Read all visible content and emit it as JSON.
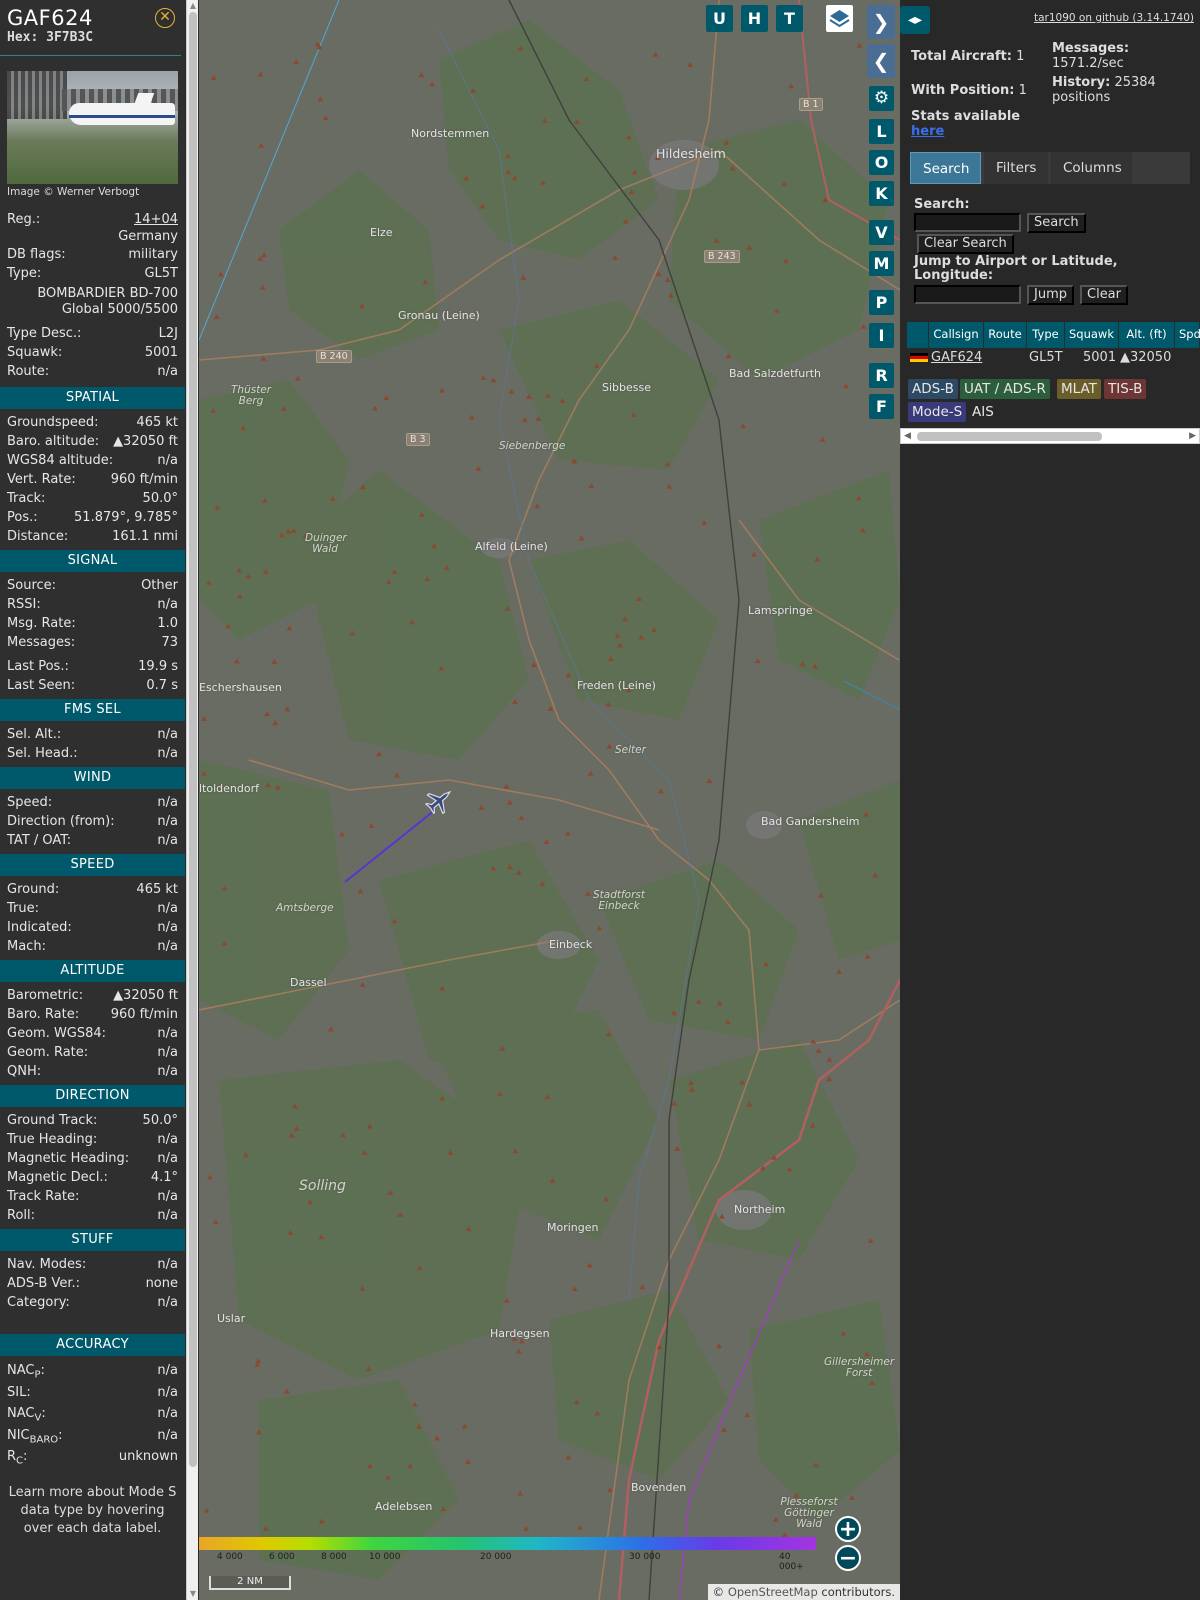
{
  "aircraft": {
    "callsign": "GAF624",
    "hex_label": "Hex: 3F7B3C",
    "image_credit": "Image © Werner Verbogt",
    "close_glyph": "⊗"
  },
  "details": [
    {
      "label": "Reg.:",
      "value": "14+04",
      "link": true
    },
    {
      "label": "",
      "value": "Germany"
    },
    {
      "label": "DB flags:",
      "value": "military"
    },
    {
      "label": "Type:",
      "value": "GL5T"
    },
    {
      "label": "",
      "value": "BOMBARDIER BD-700"
    },
    {
      "label": "",
      "value": "Global 5000/5500"
    },
    {
      "label": "Type Desc.:",
      "value": "L2J"
    },
    {
      "label": "Squawk:",
      "value": "5001"
    },
    {
      "label": "Route:",
      "value": "n/a"
    }
  ],
  "sections": {
    "spatial": {
      "title": "SPATIAL",
      "rows": [
        {
          "label": "Groundspeed:",
          "value": "465 kt"
        },
        {
          "label": "Baro. altitude:",
          "value": "▲32050 ft"
        },
        {
          "label": "WGS84 altitude:",
          "value": "n/a"
        },
        {
          "label": "Vert. Rate:",
          "value": "960 ft/min"
        },
        {
          "label": "Track:",
          "value": "50.0°"
        },
        {
          "label": "Pos.:",
          "value": "51.879°, 9.785°"
        },
        {
          "label": "Distance:",
          "value": "161.1 nmi"
        }
      ]
    },
    "signal": {
      "title": "SIGNAL",
      "rows": [
        {
          "label": "Source:",
          "value": "Other"
        },
        {
          "label": "RSSI:",
          "value": "n/a"
        },
        {
          "label": "Msg. Rate:",
          "value": "1.0"
        },
        {
          "label": "Messages:",
          "value": "73"
        },
        {
          "label": "Last Pos.:",
          "value": "19.9 s"
        },
        {
          "label": "Last Seen:",
          "value": "0.7 s"
        }
      ]
    },
    "fms": {
      "title": "FMS SEL",
      "rows": [
        {
          "label": "Sel. Alt.:",
          "value": "n/a"
        },
        {
          "label": "Sel. Head.:",
          "value": "n/a"
        }
      ]
    },
    "wind": {
      "title": "WIND",
      "rows": [
        {
          "label": "Speed:",
          "value": "n/a"
        },
        {
          "label": "Direction (from):",
          "value": "n/a"
        },
        {
          "label": "TAT / OAT:",
          "value": "n/a"
        }
      ]
    },
    "speed": {
      "title": "SPEED",
      "rows": [
        {
          "label": "Ground:",
          "value": "465 kt"
        },
        {
          "label": "True:",
          "value": "n/a"
        },
        {
          "label": "Indicated:",
          "value": "n/a"
        },
        {
          "label": "Mach:",
          "value": "n/a"
        }
      ]
    },
    "altitude": {
      "title": "ALTITUDE",
      "rows": [
        {
          "label": "Barometric:",
          "value": "▲32050 ft"
        },
        {
          "label": "Baro. Rate:",
          "value": "960 ft/min"
        },
        {
          "label": "Geom. WGS84:",
          "value": "n/a"
        },
        {
          "label": "Geom. Rate:",
          "value": "n/a"
        },
        {
          "label": "QNH:",
          "value": "n/a"
        }
      ]
    },
    "direction": {
      "title": "DIRECTION",
      "rows": [
        {
          "label": "Ground Track:",
          "value": "50.0°"
        },
        {
          "label": "True Heading:",
          "value": "n/a"
        },
        {
          "label": "Magnetic Heading:",
          "value": "n/a"
        },
        {
          "label": "Magnetic Decl.:",
          "value": "4.1°"
        },
        {
          "label": "Track Rate:",
          "value": "n/a"
        },
        {
          "label": "Roll:",
          "value": "n/a"
        }
      ]
    },
    "stuff": {
      "title": "STUFF",
      "rows": [
        {
          "label": "Nav. Modes:",
          "value": "n/a"
        },
        {
          "label": "ADS-B Ver.:",
          "value": "none"
        },
        {
          "label": "Category:",
          "value": "n/a"
        }
      ]
    },
    "accuracy": {
      "title": "ACCURACY",
      "rows": [
        {
          "label": "NAC",
          "sub": "P",
          "value": "n/a"
        },
        {
          "label": "SIL:",
          "sub": "",
          "value": "n/a"
        },
        {
          "label": "NAC",
          "sub": "V",
          "value": "n/a"
        },
        {
          "label": "NIC",
          "sub": "BARO",
          "value": "n/a"
        },
        {
          "label": "R",
          "sub": "C",
          "value": "unknown"
        }
      ]
    }
  },
  "help_note": "Learn more about Mode S data type by hovering over each data label.",
  "map": {
    "buttons": [
      "U",
      "H",
      "T",
      "L",
      "O",
      "K",
      "V",
      "M",
      "P",
      "I",
      "R",
      "F"
    ],
    "place_labels": [
      "Nordstemmen",
      "Hildesheim",
      "Elze",
      "Gronau (Leine)",
      "Sibbesse",
      "Bad Salzdetfurth",
      "Alfeld (Leine)",
      "Lamspringe",
      "Eschershausen",
      "Freden (Leine)",
      "ltoldendorf",
      "Bad Gandersheim",
      "Einbeck",
      "Dassel",
      "Northeim",
      "Moringen",
      "Uslar",
      "Hardegsen",
      "Bovenden",
      "Adelebsen"
    ],
    "forest_labels": [
      "Siebenberge",
      "Duinger Wald",
      "Thüster Berg",
      "Amtsberge",
      "Stadtforst Einbeck",
      "Selter",
      "Gillersheimer Forst",
      "Plesseforst Göttinger Wald"
    ],
    "region_label": "Solling",
    "roads": [
      "B 1",
      "B 243",
      "B 240",
      "B 3"
    ],
    "altitude_legend": [
      "4 000",
      "6 000",
      "8 000",
      "10 000",
      "20 000",
      "30 000",
      "40 000+"
    ],
    "scale": "2 NM",
    "attribution_sym": "©",
    "attribution_link": "OpenStreetMap",
    "attribution_rest": "contributors."
  },
  "right": {
    "github": "tar1090 on github (3.14.1740)",
    "total_aircraft_label": "Total Aircraft:",
    "total_aircraft": "1",
    "with_position_label": "With Position:",
    "with_position": "1",
    "messages_label": "Messages:",
    "messages": "1571.2/sec",
    "history_label": "History:",
    "history_val": "25384",
    "history_unit": "positions",
    "stats_label": "Stats available",
    "stats_link": "here",
    "tabs": [
      "Search",
      "Filters",
      "Columns"
    ],
    "search_label": "Search:",
    "search_button": "Search",
    "clear_search_button": "Clear Search",
    "jump_label": "Jump to Airport or Latitude, Longitude:",
    "jump_button": "Jump",
    "clear_button": "Clear",
    "table_headers": [
      "",
      "Callsign",
      "Route",
      "Type",
      "Squawk",
      "Alt. (ft)",
      "Spd"
    ],
    "table_row": {
      "callsign": "GAF624",
      "type": "GL5T",
      "squawk": "5001",
      "alt": "▲32050"
    },
    "sources": [
      "ADS-B",
      "UAT / ADS-R",
      "MLAT",
      "TIS-B",
      "Mode-S",
      "AIS"
    ]
  }
}
